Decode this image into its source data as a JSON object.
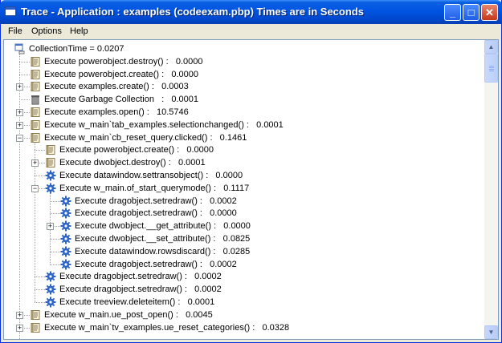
{
  "window": {
    "title": "Trace - Application : examples (codeexam.pbp) Times are in Seconds",
    "buttons": {
      "minimize": "_",
      "maximize": "□",
      "close": "✕"
    }
  },
  "menu": [
    "File",
    "Options",
    "Help"
  ],
  "tree": {
    "rows": [
      {
        "depth": 0,
        "icon": "tree-root-icon",
        "expander": "",
        "label": "CollectionTime = 0.0207"
      },
      {
        "depth": 1,
        "icon": "script-icon",
        "expander": "",
        "label": "Execute powerobject.destroy() :   0.0000"
      },
      {
        "depth": 1,
        "icon": "script-icon",
        "expander": "",
        "label": "Execute powerobject.create() :   0.0000"
      },
      {
        "depth": 1,
        "icon": "script-icon",
        "expander": "+",
        "label": "Execute examples.create() :   0.0003"
      },
      {
        "depth": 1,
        "icon": "trash-icon",
        "expander": "",
        "label": "Execute Garbage Collection   :   0.0001"
      },
      {
        "depth": 1,
        "icon": "script-icon",
        "expander": "+",
        "label": "Execute examples.open() :   10.5746"
      },
      {
        "depth": 1,
        "icon": "script-icon",
        "expander": "+",
        "label": "Execute w_main`tab_examples.selectionchanged() :   0.0001"
      },
      {
        "depth": 1,
        "icon": "script-icon",
        "expander": "−",
        "label": "Execute w_main`cb_reset_query.clicked() :   0.1461"
      },
      {
        "depth": 2,
        "icon": "script-icon",
        "expander": "",
        "label": "Execute powerobject.create() :   0.0000"
      },
      {
        "depth": 2,
        "icon": "script-icon",
        "expander": "+",
        "label": "Execute dwobject.destroy() :   0.0001"
      },
      {
        "depth": 2,
        "icon": "gear-icon",
        "expander": "",
        "label": "Execute datawindow.settransobject() :   0.0000"
      },
      {
        "depth": 2,
        "icon": "gear-icon",
        "expander": "−",
        "label": "Execute w_main.of_start_querymode() :   0.1117"
      },
      {
        "depth": 3,
        "icon": "gear-icon",
        "expander": "",
        "label": "Execute dragobject.setredraw() :   0.0002"
      },
      {
        "depth": 3,
        "icon": "gear-icon",
        "expander": "",
        "label": "Execute dragobject.setredraw() :   0.0000"
      },
      {
        "depth": 3,
        "icon": "gear-icon",
        "expander": "+",
        "label": "Execute dwobject.__get_attribute() :   0.0000"
      },
      {
        "depth": 3,
        "icon": "gear-icon",
        "expander": "",
        "label": "Execute dwobject.__set_attribute() :   0.0825"
      },
      {
        "depth": 3,
        "icon": "gear-icon",
        "expander": "",
        "label": "Execute datawindow.rowsdiscard() :   0.0285"
      },
      {
        "depth": 3,
        "icon": "gear-icon",
        "expander": "",
        "label": "Execute dragobject.setredraw() :   0.0002"
      },
      {
        "depth": 2,
        "icon": "gear-icon",
        "expander": "",
        "label": "Execute dragobject.setredraw() :   0.0002"
      },
      {
        "depth": 2,
        "icon": "gear-icon",
        "expander": "",
        "label": "Execute dragobject.setredraw() :   0.0002"
      },
      {
        "depth": 2,
        "icon": "gear-icon",
        "expander": "",
        "label": "Execute treeview.deleteitem() :   0.0001"
      },
      {
        "depth": 1,
        "icon": "script-icon",
        "expander": "+",
        "label": "Execute w_main.ue_post_open() :   0.0045"
      },
      {
        "depth": 1,
        "icon": "script-icon",
        "expander": "+",
        "label": "Execute w_main`tv_examples.ue_reset_categories() :   0.0328"
      }
    ]
  },
  "scrollbar": {
    "up_arrow": "▲",
    "down_arrow": "▼"
  },
  "colors": {
    "titlebar": "#0054E3",
    "tree_lines": "#A0A0A0",
    "gear": "#2C64C8",
    "script_page": "#FFF6D6"
  }
}
